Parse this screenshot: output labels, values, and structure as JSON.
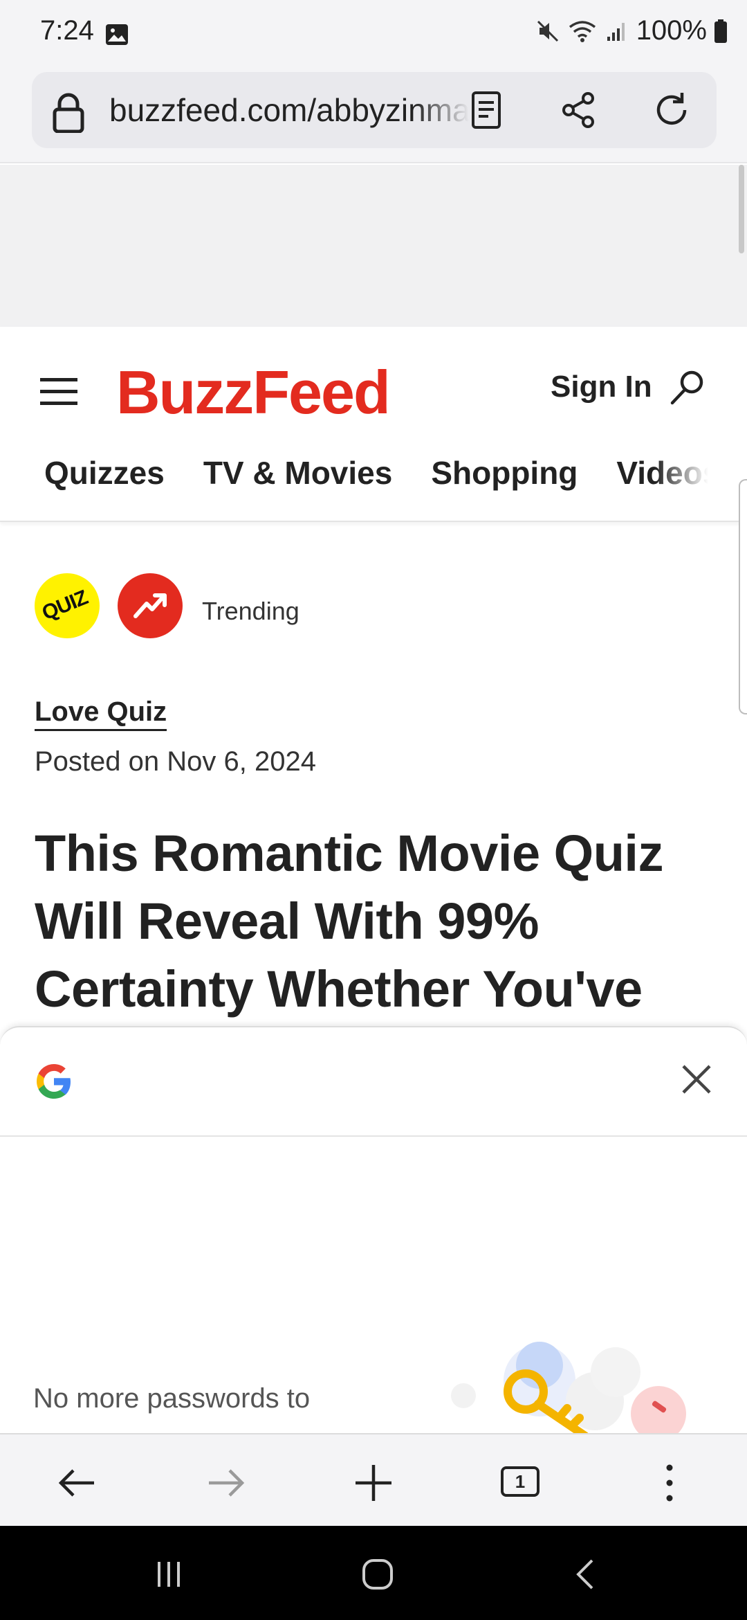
{
  "status_bar": {
    "time": "7:24",
    "battery": "100%"
  },
  "browser": {
    "url": "buzzfeed.com/abbyzinman/romantic-movie-quiz",
    "tab_count": "1"
  },
  "site": {
    "logo": "BuzzFeed",
    "sign_in": "Sign In",
    "nav_tabs": [
      "Quizzes",
      "TV & Movies",
      "Shopping",
      "Videos"
    ]
  },
  "article": {
    "badge_quiz": "QUIZ",
    "badge_trending_label": "Trending",
    "category": "Love Quiz",
    "posted": "Posted on Nov 6, 2024",
    "headline": "This Romantic Movie Quiz Will Reveal With 99% Certainty Whether You've"
  },
  "google_sheet": {
    "text": "No more passwords to"
  },
  "colors": {
    "brand_red": "#e32b1f",
    "quiz_yellow": "#fff200",
    "chrome_bg": "#f4f4f6"
  }
}
